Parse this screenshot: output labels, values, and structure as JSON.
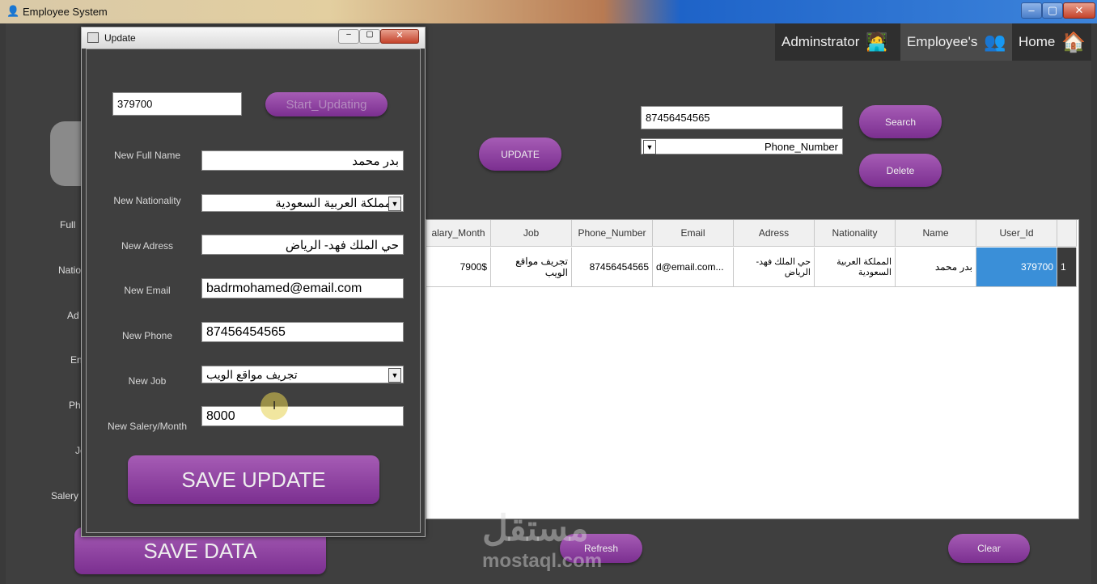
{
  "window": {
    "title": "Employee System"
  },
  "nav": {
    "admin": "Adminstrator",
    "employees": "Employee's",
    "home": "Home"
  },
  "search": {
    "value": "87456454565",
    "button": "Search",
    "filter": "Phone_Number",
    "delete": "Delete"
  },
  "main": {
    "update_button": "UPDATE",
    "save_data": "SAVE DATA",
    "refresh": "Refresh",
    "clear": "Clear",
    "side_labels": [
      "Full",
      "Natio",
      "Ad",
      "En",
      "Ph",
      "Jo",
      "Salery"
    ]
  },
  "table": {
    "columns": [
      "alary_Month",
      "Job",
      "Phone_Number",
      "Email",
      "Adress",
      "Nationality",
      "Name",
      "User_Id"
    ],
    "rows": [
      {
        "salary": "7900$",
        "job": "تجريف مواقع الويب",
        "phone": "87456454565",
        "email": "d@email.com...",
        "address": "حي الملك فهد- الرياض",
        "nationality": "المملكة العربية السعودية",
        "name": "بدر محمد",
        "user_id": "379700",
        "index": "1"
      }
    ]
  },
  "dialog": {
    "title": "Update",
    "id_value": "379700",
    "start_button": "Start_Updating",
    "labels": {
      "name": "New Full Name",
      "nationality": "New Nationality",
      "address": "New Adress",
      "email": "New Email",
      "phone": "New Phone",
      "job": "New Job",
      "salary": "New Salery/Month"
    },
    "values": {
      "name": "بدر محمد",
      "nationality": "المملكة العربية السعودية",
      "address": "حي الملك فهد-  الرياض",
      "email": "badrmohamed@email.com",
      "phone": "87456454565",
      "job": "تجريف مواقع الويب",
      "salary": "8000"
    },
    "save_button": "SAVE UPDATE"
  },
  "watermark": {
    "arabic": "مستقل",
    "latin": "mostaql.com"
  }
}
